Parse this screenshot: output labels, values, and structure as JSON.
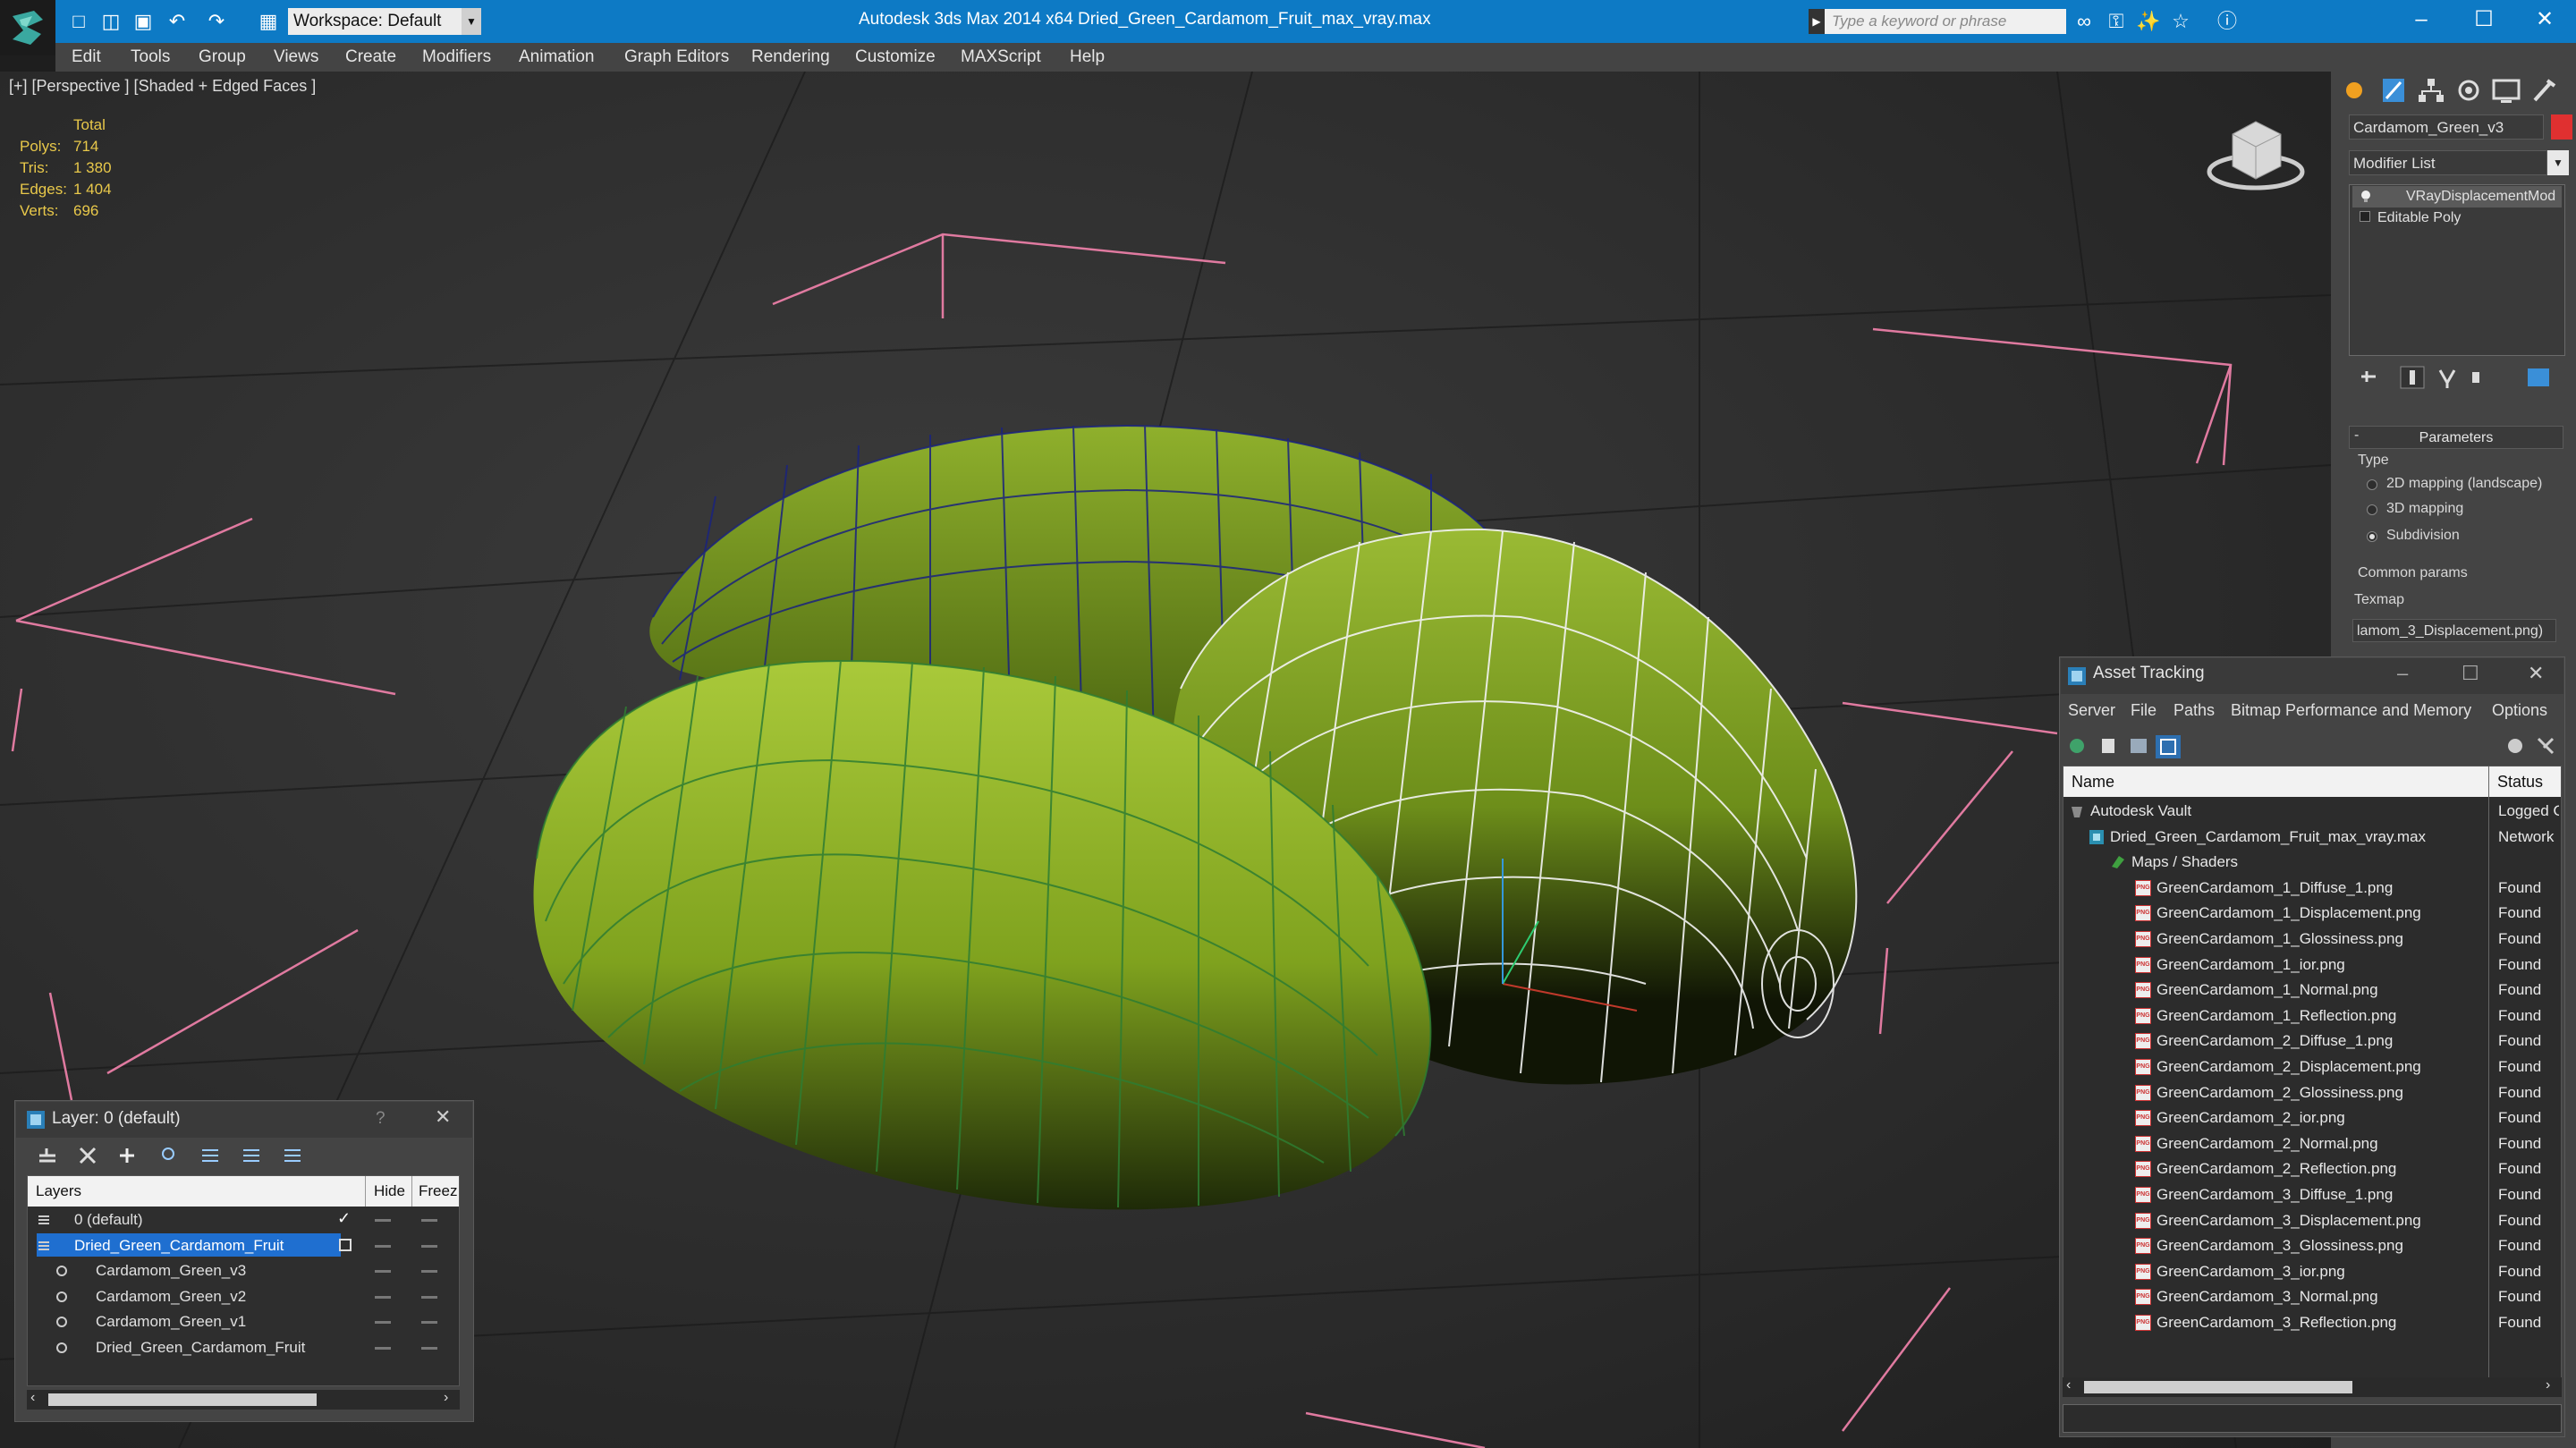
{
  "titlebar": {
    "app_title": "Autodesk 3ds Max  2014 x64     Dried_Green_Cardamom_Fruit_max_vray.max",
    "workspace": "Workspace: Default",
    "search_placeholder": "Type a keyword or phrase"
  },
  "menu": [
    "Edit",
    "Tools",
    "Group",
    "Views",
    "Create",
    "Modifiers",
    "Animation",
    "Graph Editors",
    "Rendering",
    "Customize",
    "MAXScript",
    "Help"
  ],
  "viewport": {
    "label": "[+] [Perspective ] [Shaded + Edged Faces ]",
    "stats_total": "Total",
    "stats": [
      {
        "label": "Polys:",
        "value": "714"
      },
      {
        "label": "Tris:",
        "value": "1 380"
      },
      {
        "label": "Edges:",
        "value": "1 404"
      },
      {
        "label": "Verts:",
        "value": "696"
      }
    ]
  },
  "command_panel": {
    "object_name": "Cardamom_Green_v3",
    "modifier_list": "Modifier List",
    "stack": [
      "VRayDisplacementMod",
      "Editable Poly"
    ],
    "parameters": "Parameters",
    "type_label": "Type",
    "type_options": [
      "2D mapping (landscape)",
      "3D mapping",
      "Subdivision"
    ],
    "type_selected": 2,
    "common_params": "Common params",
    "texmap_label": "Texmap",
    "texmap_value": "lamom_3_Displacement.png)"
  },
  "asset_tracking": {
    "title": "Asset Tracking",
    "menu": [
      "Server",
      "File",
      "Paths",
      "Bitmap Performance and Memory",
      "Options"
    ],
    "col_name": "Name",
    "col_status": "Status",
    "rows": [
      {
        "name": "Autodesk Vault",
        "status": "Logged O",
        "indent": 0,
        "icon": "vault"
      },
      {
        "name": "Dried_Green_Cardamom_Fruit_max_vray.max",
        "status": "Network",
        "indent": 1,
        "icon": "max"
      },
      {
        "name": "Maps / Shaders",
        "status": "",
        "indent": 2,
        "icon": "folder"
      },
      {
        "name": "GreenCardamom_1_Diffuse_1.png",
        "status": "Found",
        "indent": 3,
        "icon": "png"
      },
      {
        "name": "GreenCardamom_1_Displacement.png",
        "status": "Found",
        "indent": 3,
        "icon": "png"
      },
      {
        "name": "GreenCardamom_1_Glossiness.png",
        "status": "Found",
        "indent": 3,
        "icon": "png"
      },
      {
        "name": "GreenCardamom_1_ior.png",
        "status": "Found",
        "indent": 3,
        "icon": "png"
      },
      {
        "name": "GreenCardamom_1_Normal.png",
        "status": "Found",
        "indent": 3,
        "icon": "png"
      },
      {
        "name": "GreenCardamom_1_Reflection.png",
        "status": "Found",
        "indent": 3,
        "icon": "png"
      },
      {
        "name": "GreenCardamom_2_Diffuse_1.png",
        "status": "Found",
        "indent": 3,
        "icon": "png"
      },
      {
        "name": "GreenCardamom_2_Displacement.png",
        "status": "Found",
        "indent": 3,
        "icon": "png"
      },
      {
        "name": "GreenCardamom_2_Glossiness.png",
        "status": "Found",
        "indent": 3,
        "icon": "png"
      },
      {
        "name": "GreenCardamom_2_ior.png",
        "status": "Found",
        "indent": 3,
        "icon": "png"
      },
      {
        "name": "GreenCardamom_2_Normal.png",
        "status": "Found",
        "indent": 3,
        "icon": "png"
      },
      {
        "name": "GreenCardamom_2_Reflection.png",
        "status": "Found",
        "indent": 3,
        "icon": "png"
      },
      {
        "name": "GreenCardamom_3_Diffuse_1.png",
        "status": "Found",
        "indent": 3,
        "icon": "png"
      },
      {
        "name": "GreenCardamom_3_Displacement.png",
        "status": "Found",
        "indent": 3,
        "icon": "png"
      },
      {
        "name": "GreenCardamom_3_Glossiness.png",
        "status": "Found",
        "indent": 3,
        "icon": "png"
      },
      {
        "name": "GreenCardamom_3_ior.png",
        "status": "Found",
        "indent": 3,
        "icon": "png"
      },
      {
        "name": "GreenCardamom_3_Normal.png",
        "status": "Found",
        "indent": 3,
        "icon": "png"
      },
      {
        "name": "GreenCardamom_3_Reflection.png",
        "status": "Found",
        "indent": 3,
        "icon": "png"
      }
    ]
  },
  "layer_manager": {
    "title": "Layer: 0 (default)",
    "help": "?",
    "col_layers": "Layers",
    "col_hide": "Hide",
    "col_freeze": "Freeze",
    "rows": [
      {
        "name": "0 (default)",
        "level": 0,
        "current": true,
        "selected": false
      },
      {
        "name": "Dried_Green_Cardamom_Fruit",
        "level": 0,
        "current": false,
        "selected": true
      },
      {
        "name": "Cardamom_Green_v3",
        "level": 1,
        "current": false,
        "selected": false
      },
      {
        "name": "Cardamom_Green_v2",
        "level": 1,
        "current": false,
        "selected": false
      },
      {
        "name": "Cardamom_Green_v1",
        "level": 1,
        "current": false,
        "selected": false
      },
      {
        "name": "Dried_Green_Cardamom_Fruit",
        "level": 1,
        "current": false,
        "selected": false
      }
    ]
  },
  "colors": {
    "titlebar_blue": "#0d7ac5",
    "selection_blue": "#1f6fd0",
    "stat_yellow": "#e8c84a",
    "gizmo_pink": "#e07aa0"
  }
}
